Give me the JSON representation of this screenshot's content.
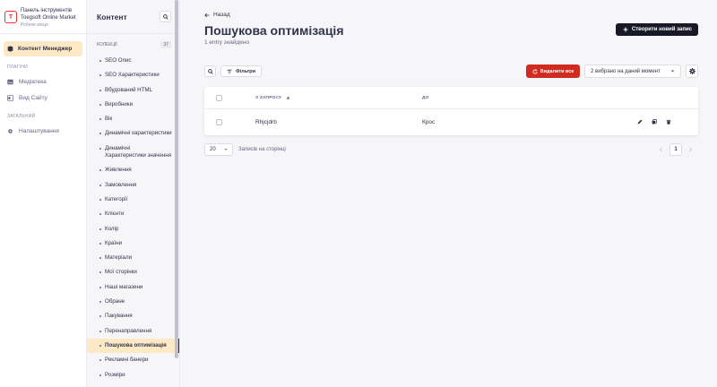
{
  "brand": {
    "title_line1": "Панель інструментів",
    "title_line2": "Toegsoft Online Market",
    "subtitle": "Робоче місце",
    "logo": "T"
  },
  "nav": {
    "active": "Контент Менеджер",
    "plugins_section": "ПЛАГІНИ",
    "plugins": [
      "Медіатека",
      "Вид Сайту"
    ],
    "general_section": "ЗАГАЛЬНИЙ",
    "general": [
      "Налаштування"
    ]
  },
  "sidebar": {
    "title": "Контент",
    "collections_label": "КОЛЕКЦІЇ",
    "collections_count": "37",
    "items": [
      "SEO Опис",
      "SEO Характеристики",
      "Вбудований HTML",
      "Виробники",
      "Вік",
      "Динамічні характеристики",
      "Динамічні Характеристики значення",
      "Живлення",
      "Замовлення",
      "Категорії",
      "Клієнти",
      "Колір",
      "Країни",
      "Матеріали",
      "Мої сторінки",
      "Наші магазини",
      "Обране",
      "Пакування",
      "Перенаправлення",
      "Пошукова оптимізація",
      "Рекламні банери",
      "Розміри"
    ]
  },
  "main": {
    "back": "Назад",
    "title": "Пошукова оптимізація",
    "subtitle": "1 entry знайдено",
    "create_button": "Створити новий запис",
    "filters_button": "Фільтри",
    "delete_button": "Видалити все",
    "selection": "2 вибрано на даний момент",
    "table": {
      "col_query": "З ЗАПРОСУ",
      "col_to": "ДО",
      "rows": [
        {
          "query": "Rhjcjdrb",
          "to": "Крос"
        }
      ]
    },
    "pagination": {
      "per_page": "20",
      "per_page_label": "Записів на сторінці",
      "current_page": "1"
    }
  },
  "colors": {
    "accent": "#fde9c6",
    "danger": "#d02b20",
    "dark": "#181826"
  }
}
